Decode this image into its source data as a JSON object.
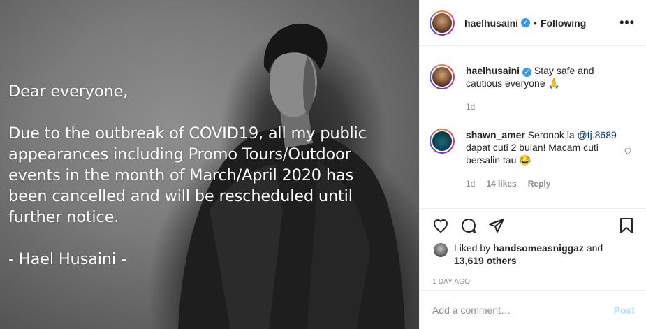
{
  "photo": {
    "lines": [
      "Dear everyone,",
      "Due to the outbreak of COVID19, all my public",
      "appearances including Promo Tours/Outdoor",
      "events in the month of March/April 2020 has",
      "been cancelled and will be rescheduled until",
      "further notice.",
      "- Hael Husaini -"
    ]
  },
  "header": {
    "username": "haelhusaini",
    "dot": "•",
    "following": "Following",
    "more": "•••"
  },
  "caption": {
    "username": "haelhusaini",
    "text": " Stay safe and cautious everyone 🙏",
    "time": "1d"
  },
  "comment": {
    "username": "shawn_amer",
    "text_before": " Seronok la ",
    "mention": "@tj.8689",
    "text_after": " dapat cuti 2 bulan! Macam cuti bersalin tau 😂",
    "time": "1d",
    "likes": "14 likes",
    "reply": "Reply"
  },
  "likes": {
    "prefix": "Liked by ",
    "user": "handsomeasniggaz",
    "middle": " and",
    "count": "13,619 others"
  },
  "posted": "1 DAY AGO",
  "add_comment": {
    "placeholder": "Add a comment…",
    "post": "Post"
  },
  "colors": {
    "verified": "#3897f0",
    "post_disabled": "#b2dffc",
    "mention": "#003569",
    "muted": "#8e8e8e"
  }
}
